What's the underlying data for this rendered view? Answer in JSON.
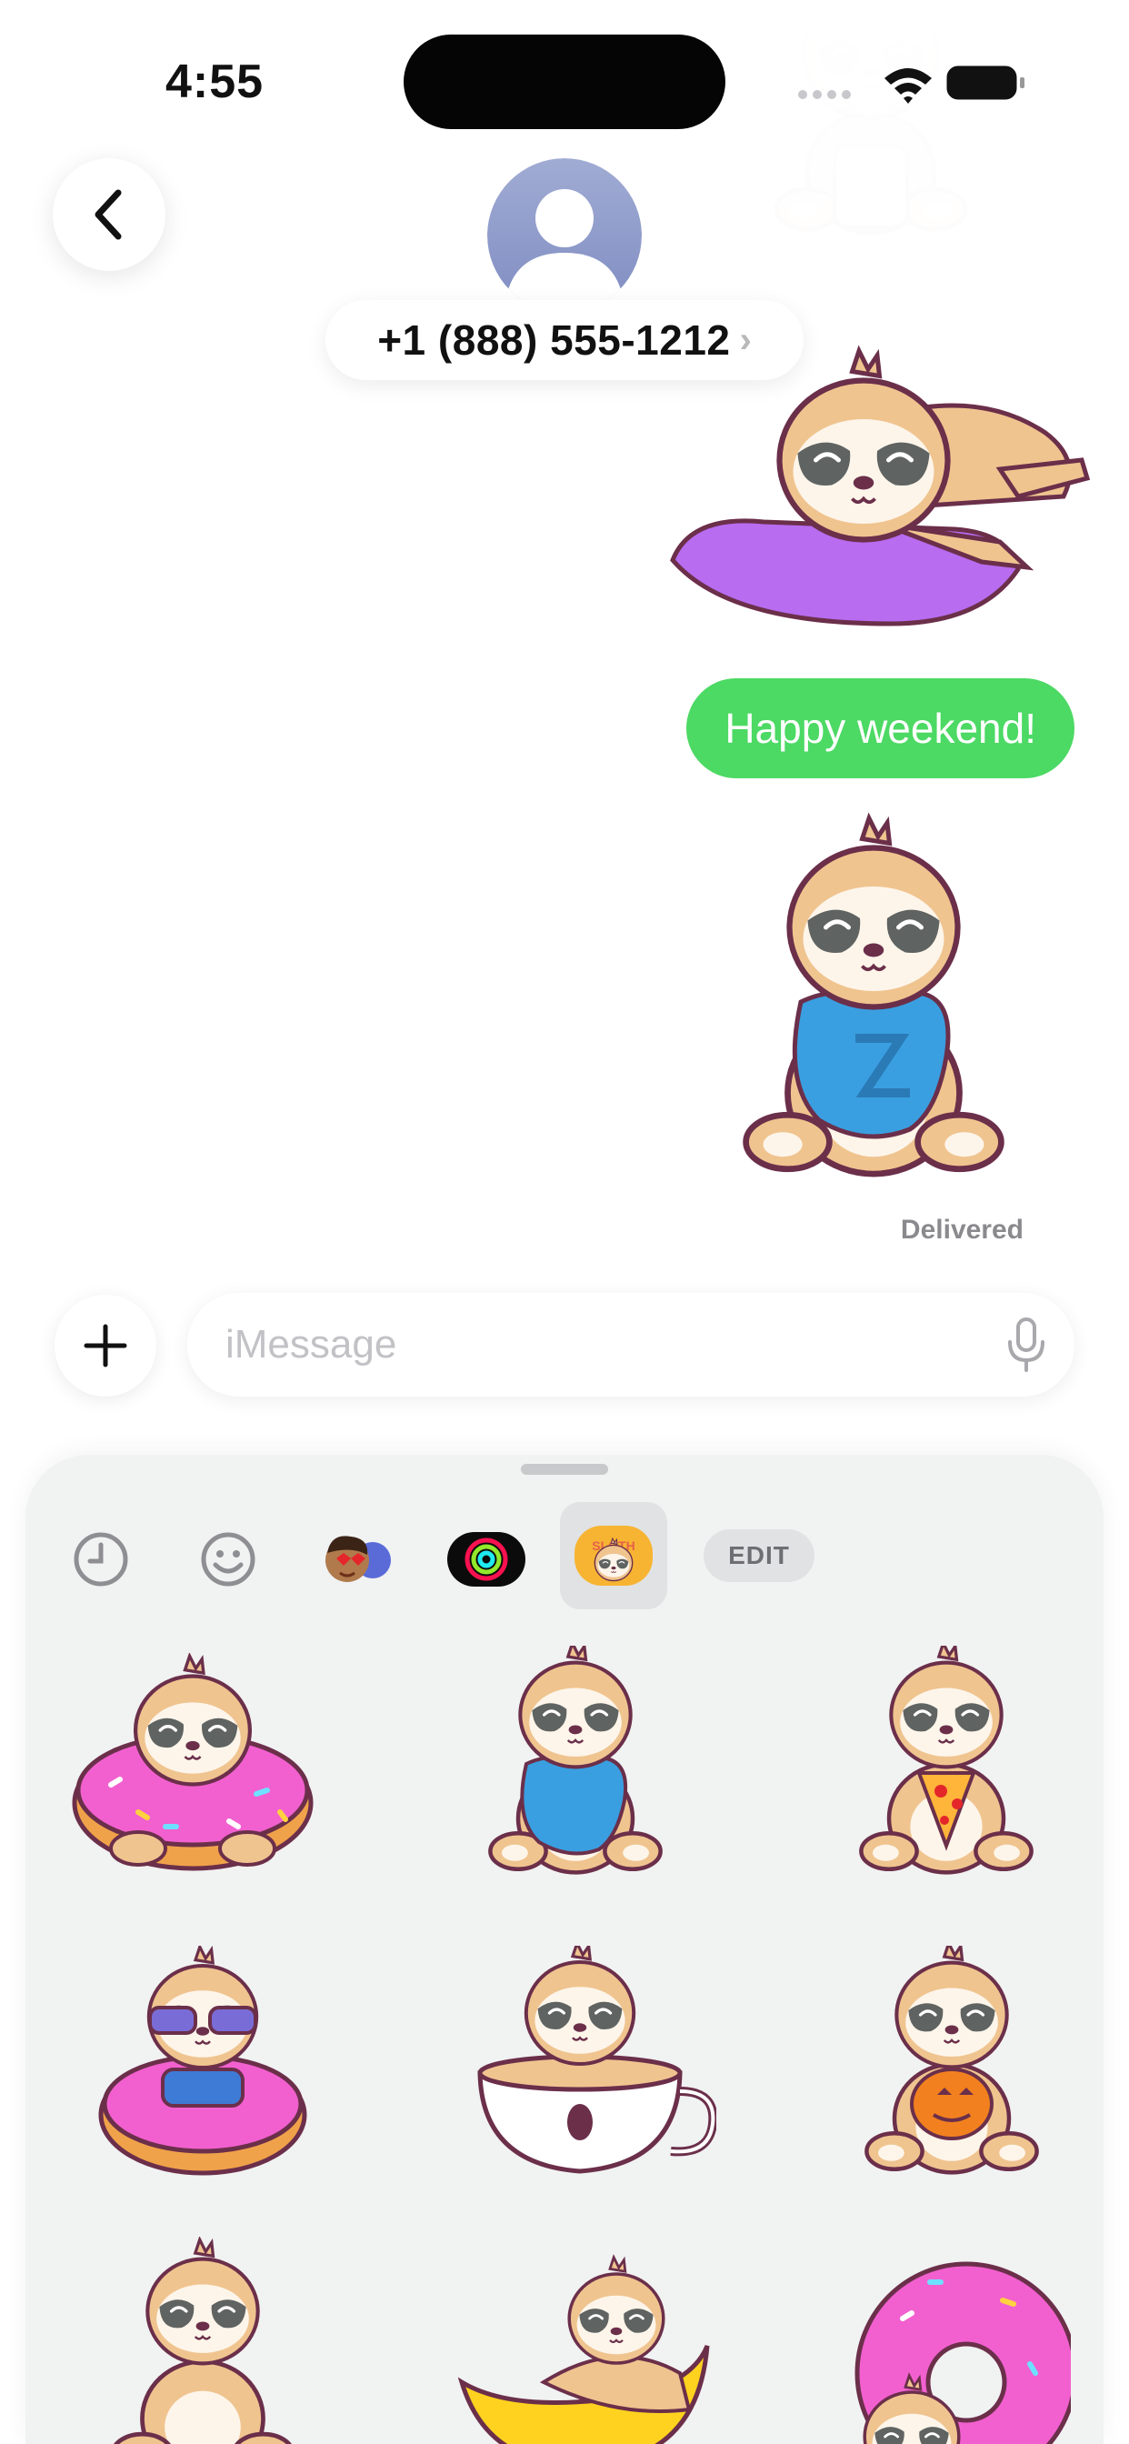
{
  "status_bar": {
    "time": "4:55"
  },
  "header": {
    "contact": "+1 (888) 555-1212",
    "chevron": "›"
  },
  "messages": {
    "bubble_text": "Happy weekend!",
    "status": "Delivered"
  },
  "compose": {
    "placeholder": "iMessage"
  },
  "sticker_panel": {
    "tabs": [
      "recents-icon",
      "emoji-icon",
      "memoji-stickers",
      "activity-rings",
      "sloth-sticker-pack"
    ],
    "edit_label": "EDIT",
    "pack_badge_text": "SLOTH",
    "stickers": [
      "sloth-donut",
      "sloth-blue-pillow",
      "sloth-pizza",
      "sloth-sunglasses-donut",
      "sloth-coffee-cup",
      "sloth-pumpkin",
      "sloth-meditating",
      "sloth-moon",
      "sloth-big-donut"
    ]
  },
  "colors": {
    "bubble": "#4cd964",
    "sloth_fur": "#f0c48f",
    "sloth_face": "#5f6361",
    "outline": "#6b2f4a",
    "panel_bg": "#f1f2f2"
  }
}
